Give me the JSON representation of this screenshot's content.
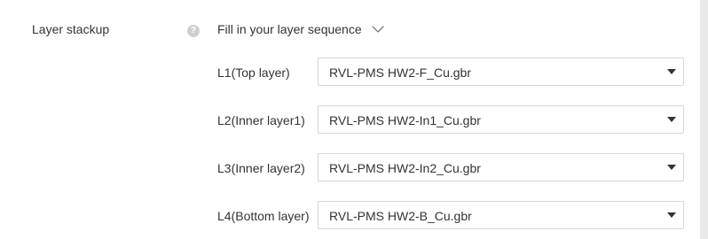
{
  "layer_stackup": {
    "label": "Layer stackup",
    "help_icon": "question-mark-icon",
    "help_glyph": "?",
    "sequence_toggle": {
      "label": "Fill in your layer sequence",
      "icon": "chevron-down-icon"
    },
    "layers": [
      {
        "label": "L1(Top layer)",
        "value": "RVL-PMS HW2-F_Cu.gbr"
      },
      {
        "label": "L2(Inner layer1)",
        "value": "RVL-PMS HW2-In1_Cu.gbr"
      },
      {
        "label": "L3(Inner layer2)",
        "value": "RVL-PMS HW2-In2_Cu.gbr"
      },
      {
        "label": "L4(Bottom layer)",
        "value": "RVL-PMS HW2-B_Cu.gbr"
      }
    ],
    "select_caret_icon": "caret-down-icon"
  },
  "colors": {
    "text": "#333333",
    "border": "#d7d7d7",
    "help_icon_background": "#cfcfcf",
    "caret": "#333333",
    "page_edge": "#e9e9e9"
  }
}
